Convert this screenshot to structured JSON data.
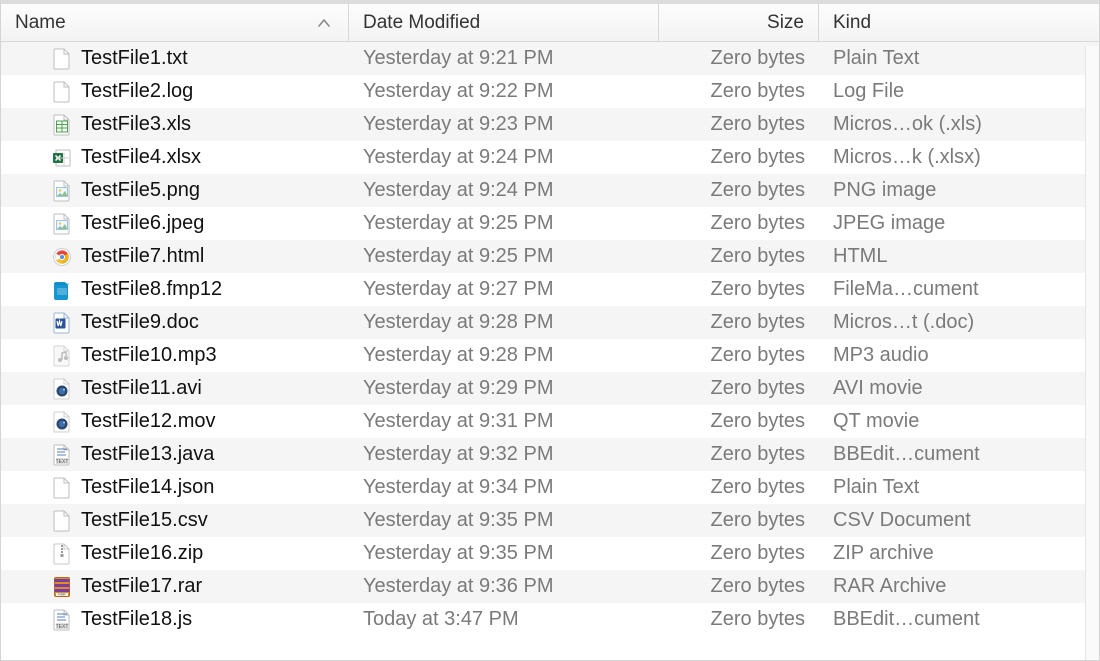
{
  "columns": {
    "name": "Name",
    "date": "Date Modified",
    "size": "Size",
    "kind": "Kind"
  },
  "sort": {
    "column": "name",
    "direction": "asc"
  },
  "files": [
    {
      "icon": "txt",
      "name": "TestFile1.txt",
      "date": "Yesterday at 9:21 PM",
      "size": "Zero bytes",
      "kind": "Plain Text"
    },
    {
      "icon": "txt",
      "name": "TestFile2.log",
      "date": "Yesterday at 9:22 PM",
      "size": "Zero bytes",
      "kind": "Log File"
    },
    {
      "icon": "xls",
      "name": "TestFile3.xls",
      "date": "Yesterday at 9:23 PM",
      "size": "Zero bytes",
      "kind": "Micros…ok (.xls)"
    },
    {
      "icon": "xlsx",
      "name": "TestFile4.xlsx",
      "date": "Yesterday at 9:24 PM",
      "size": "Zero bytes",
      "kind": "Micros…k (.xlsx)"
    },
    {
      "icon": "png",
      "name": "TestFile5.png",
      "date": "Yesterday at 9:24 PM",
      "size": "Zero bytes",
      "kind": "PNG image"
    },
    {
      "icon": "jpeg",
      "name": "TestFile6.jpeg",
      "date": "Yesterday at 9:25 PM",
      "size": "Zero bytes",
      "kind": "JPEG image"
    },
    {
      "icon": "html",
      "name": "TestFile7.html",
      "date": "Yesterday at 9:25 PM",
      "size": "Zero bytes",
      "kind": "HTML"
    },
    {
      "icon": "fmp",
      "name": "TestFile8.fmp12",
      "date": "Yesterday at 9:27 PM",
      "size": "Zero bytes",
      "kind": "FileMa…cument"
    },
    {
      "icon": "doc",
      "name": "TestFile9.doc",
      "date": "Yesterday at 9:28 PM",
      "size": "Zero bytes",
      "kind": "Micros…t (.doc)"
    },
    {
      "icon": "mp3",
      "name": "TestFile10.mp3",
      "date": "Yesterday at 9:28 PM",
      "size": "Zero bytes",
      "kind": "MP3 audio"
    },
    {
      "icon": "avi",
      "name": "TestFile11.avi",
      "date": "Yesterday at 9:29 PM",
      "size": "Zero bytes",
      "kind": "AVI movie"
    },
    {
      "icon": "mov",
      "name": "TestFile12.mov",
      "date": "Yesterday at 9:31 PM",
      "size": "Zero bytes",
      "kind": "QT movie"
    },
    {
      "icon": "bbedit",
      "name": "TestFile13.java",
      "date": "Yesterday at 9:32 PM",
      "size": "Zero bytes",
      "kind": "BBEdit…cument"
    },
    {
      "icon": "txt",
      "name": "TestFile14.json",
      "date": "Yesterday at 9:34 PM",
      "size": "Zero bytes",
      "kind": "Plain Text"
    },
    {
      "icon": "txt",
      "name": "TestFile15.csv",
      "date": "Yesterday at 9:35 PM",
      "size": "Zero bytes",
      "kind": "CSV Document"
    },
    {
      "icon": "zip",
      "name": "TestFile16.zip",
      "date": "Yesterday at 9:35 PM",
      "size": "Zero bytes",
      "kind": "ZIP archive"
    },
    {
      "icon": "rar",
      "name": "TestFile17.rar",
      "date": "Yesterday at 9:36 PM",
      "size": "Zero bytes",
      "kind": "RAR Archive"
    },
    {
      "icon": "bbedit",
      "name": "TestFile18.js",
      "date": "Today at 3:47 PM",
      "size": "Zero bytes",
      "kind": "BBEdit…cument"
    }
  ]
}
